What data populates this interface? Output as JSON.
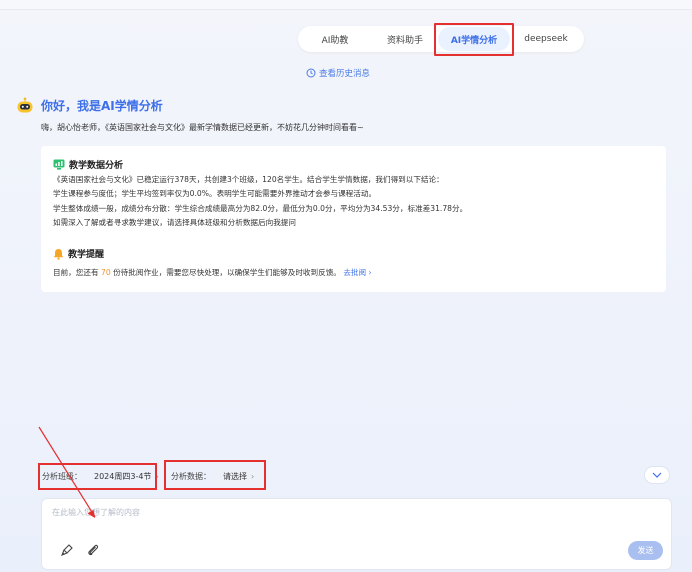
{
  "tabs": [
    {
      "label": "AI助教"
    },
    {
      "label": "资料助手"
    },
    {
      "label": "AI学情分析",
      "active": true
    },
    {
      "label": "deepseek"
    }
  ],
  "history_link": "查看历史消息",
  "greeting": {
    "title": "你好，我是AI学情分析",
    "subtitle": "嗨，胡心怡老师，《英语国家社会与文化》最新学情数据已经更新，不妨花几分钟时间看看~"
  },
  "analysis": {
    "heading": "教学数据分析",
    "lines": [
      "《英语国家社会与文化》已稳定运行378天，共创建3个班级，120名学生。结合学生学情数据，我们得到以下结论：",
      "学生课程参与度低；学生平均签到率仅为0.0%。表明学生可能需要外界推动才会参与课程活动。",
      "学生整体成绩一般，成绩分布分散：学生综合成绩最高分为82.0分，最低分为0.0分，平均分为34.53分，标准差31.78分。",
      "如需深入了解或者寻求教学建议，请选择具体班级和分析数据后向我提问"
    ]
  },
  "reminder": {
    "heading": "教学提醒",
    "prefix": "目前，您还有",
    "count": "70",
    "suffix": "份待批阅作业，需要您尽快处理，以确保学生们能够及时收到反馈。",
    "link": "去批阅"
  },
  "filters": {
    "class_label": "分析班级：",
    "class_value": "2024周四3-4节",
    "data_label": "分析数据：",
    "data_value": "请选择"
  },
  "input": {
    "placeholder": "在此输入您想了解的内容",
    "send_label": "发送"
  },
  "colors": {
    "accent": "#3d6fe8",
    "highlight": "#e53030",
    "count": "#f0932b"
  }
}
